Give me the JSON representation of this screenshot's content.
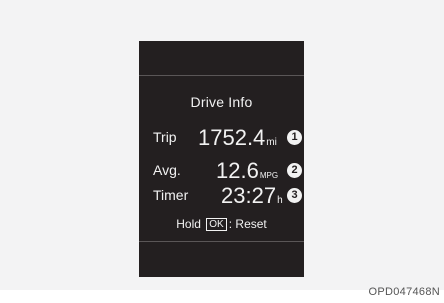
{
  "screen": {
    "title": "Drive Info",
    "rows": [
      {
        "label": "Trip",
        "value": "1752.4",
        "unit": "mi",
        "marker": "1"
      },
      {
        "label": "Avg.",
        "value": "12.6",
        "unit": "MPG",
        "marker": "2"
      },
      {
        "label": "Timer",
        "value": "23:27",
        "unit": "h",
        "marker": "3"
      }
    ],
    "footer": {
      "prefix": "Hold",
      "key": "OK",
      "suffix": ": Reset"
    }
  },
  "figure_code": "OPD047468N"
}
